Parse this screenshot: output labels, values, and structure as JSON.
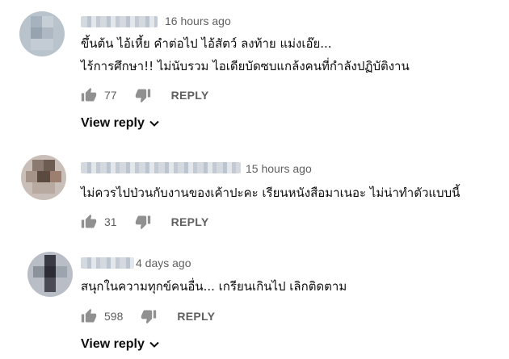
{
  "comments": [
    {
      "time": "16 hours ago",
      "lines": [
        "ขึ้นต้น ไอ้เหี้ย คำต่อไป ไอ้สัตว์ ลงท้าย แม่งเอ๊ย...",
        "ไร้การศึกษา!! ไม่นับรวม ไอเดียบัดซบแกล้งคนที่กำลังปฏิบัติงาน"
      ],
      "likes": "77",
      "reply_label": "REPLY",
      "view_reply_label": "View reply"
    },
    {
      "time": "15 hours ago",
      "lines": [
        "ไม่ควรไปป่วนกับงานของเค้าปะคะ เรียนหนังสือมาเนอะ ไม่น่าทำตัวแบบนี้"
      ],
      "likes": "31",
      "reply_label": "REPLY"
    },
    {
      "time": "4 days ago",
      "lines": [
        "สนุกในความทุกข์คนอื่น...  เกรียนเกินไป เลิกติดตาม"
      ],
      "likes": "598",
      "reply_label": "REPLY",
      "view_reply_label": "View reply"
    }
  ],
  "icons": {
    "like": "thumbs-up-icon",
    "dislike": "thumbs-down-icon",
    "expand": "chevron-down-icon"
  },
  "colors": {
    "text": "#0d0d0d",
    "meta": "#606060",
    "icon": "#909090"
  }
}
